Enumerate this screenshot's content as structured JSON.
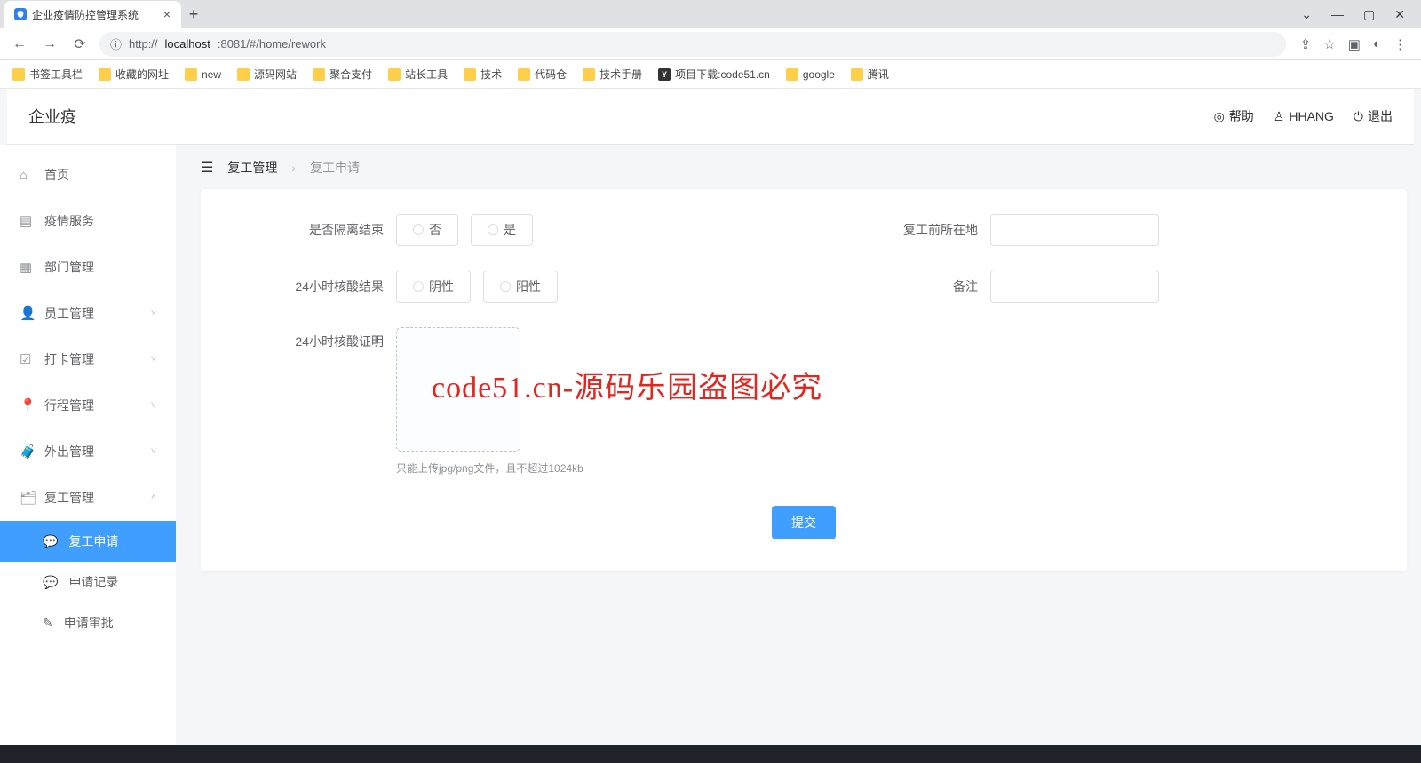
{
  "browser": {
    "tab_title": "企业疫情防控管理系统",
    "url_prefix": "http://",
    "url_host": "localhost",
    "url_rest": ":8081/#/home/rework",
    "bookmarks": [
      {
        "label": "书签工具栏",
        "kind": "folder"
      },
      {
        "label": "收藏的网址",
        "kind": "folder"
      },
      {
        "label": "new",
        "kind": "folder"
      },
      {
        "label": "源码网站",
        "kind": "folder"
      },
      {
        "label": "聚合支付",
        "kind": "folder"
      },
      {
        "label": "站长工具",
        "kind": "folder"
      },
      {
        "label": "技术",
        "kind": "folder"
      },
      {
        "label": "代码仓",
        "kind": "folder"
      },
      {
        "label": "技术手册",
        "kind": "folder"
      },
      {
        "label": "项目下载:code51.cn",
        "kind": "page"
      },
      {
        "label": "google",
        "kind": "folder"
      },
      {
        "label": "腾讯",
        "kind": "folder"
      }
    ]
  },
  "header": {
    "brand": "企业疫",
    "help": "帮助",
    "user": "HHANG",
    "logout": "退出"
  },
  "sidebar": {
    "items": [
      {
        "icon": "home",
        "label": "首页",
        "expandable": false
      },
      {
        "icon": "grid",
        "label": "疫情服务",
        "expandable": false
      },
      {
        "icon": "dept",
        "label": "部门管理",
        "expandable": false
      },
      {
        "icon": "user",
        "label": "员工管理",
        "expandable": true,
        "open": false
      },
      {
        "icon": "clock",
        "label": "打卡管理",
        "expandable": true,
        "open": false
      },
      {
        "icon": "pin",
        "label": "行程管理",
        "expandable": true,
        "open": false
      },
      {
        "icon": "case",
        "label": "外出管理",
        "expandable": true,
        "open": false
      },
      {
        "icon": "rework",
        "label": "复工管理",
        "expandable": true,
        "open": true
      }
    ],
    "rework_sub": [
      {
        "icon": "chat",
        "label": "复工申请",
        "active": true
      },
      {
        "icon": "chat",
        "label": "申请记录",
        "active": false
      },
      {
        "icon": "approve",
        "label": "申请审批",
        "active": false
      }
    ]
  },
  "crumb": {
    "root": "复工管理",
    "current": "复工申请"
  },
  "form": {
    "quarantine_label": "是否隔离结束",
    "quarantine_no": "否",
    "quarantine_yes": "是",
    "location_label": "复工前所在地",
    "location_value": "",
    "nat_label": "24小时核酸结果",
    "nat_neg": "阴性",
    "nat_pos": "阳性",
    "remark_label": "备注",
    "remark_value": "",
    "proof_label": "24小时核酸证明",
    "upload_hint": "只能上传jpg/png文件，且不超过1024kb",
    "submit": "提交"
  },
  "watermark": "code51.cn-源码乐园盗图必究"
}
